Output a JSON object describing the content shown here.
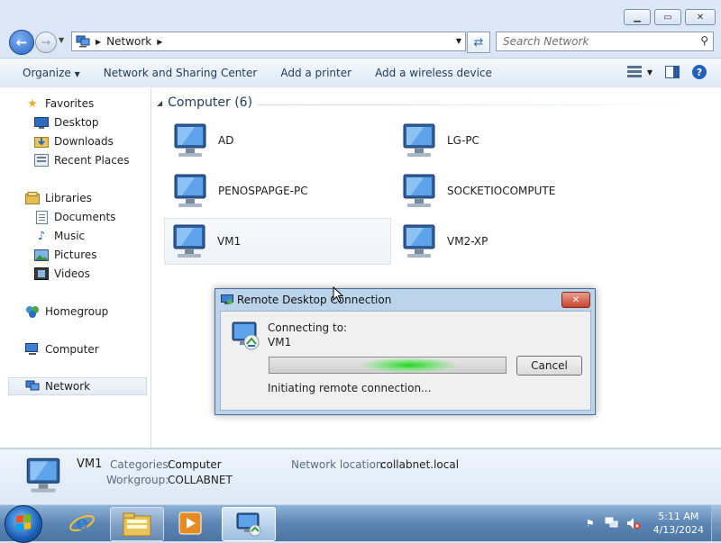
{
  "window": {
    "caption_buttons": [
      "minimize",
      "maximize",
      "close"
    ]
  },
  "address": {
    "crumb": "Network",
    "search_placeholder": "Search Network"
  },
  "toolbar": {
    "organize": "Organize",
    "network_center": "Network and Sharing Center",
    "add_printer": "Add a printer",
    "add_wireless": "Add a wireless device"
  },
  "sidebar": {
    "favorites": "Favorites",
    "desktop": "Desktop",
    "downloads": "Downloads",
    "recent": "Recent Places",
    "libraries": "Libraries",
    "documents": "Documents",
    "music": "Music",
    "pictures": "Pictures",
    "videos": "Videos",
    "homegroup": "Homegroup",
    "computer": "Computer",
    "network": "Network"
  },
  "content": {
    "group_title": "Computer (6)",
    "computers": [
      "AD",
      "LG-PC",
      "PENOSPAPGE-PC",
      "SOCKETIOCOMPUTE",
      "VM1",
      "VM2-XP"
    ]
  },
  "details": {
    "name": "VM1",
    "categories_label": "Categories:",
    "categories_value": "Computer",
    "workgroup_label": "Workgroup:",
    "workgroup_value": "COLLABNET",
    "location_label": "Network location:",
    "location_value": "collabnet.local"
  },
  "dialog": {
    "title": "Remote Desktop Connection",
    "connecting_to": "Connecting to:",
    "host": "VM1",
    "cancel": "Cancel",
    "status": "Initiating remote connection..."
  },
  "taskbar": {
    "time": "5:11 AM",
    "date": "4/13/2024"
  },
  "colors": {
    "accent": "#2a64c8",
    "progress": "#22d422"
  }
}
